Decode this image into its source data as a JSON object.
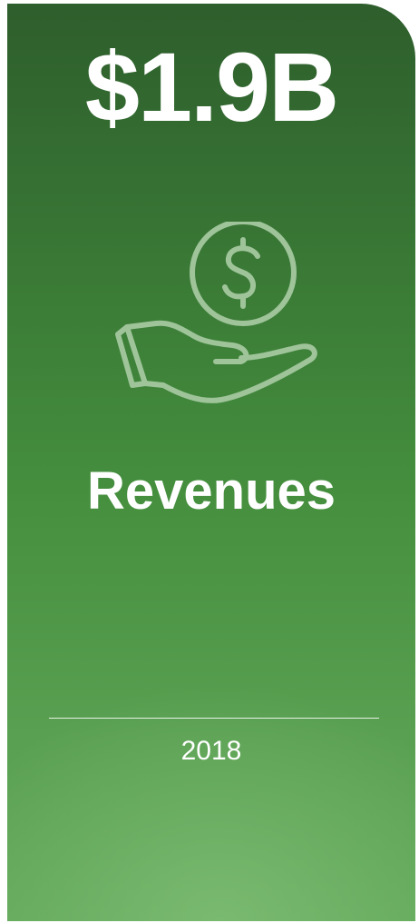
{
  "card": {
    "headline": "$1.9B",
    "label": "Revenues",
    "year": "2018",
    "icon": "hand-holding-dollar-icon",
    "colors": {
      "background_top": "#2e5e2c",
      "background_bottom": "#62a85a",
      "text": "#ffffff",
      "icon_stroke": "#9fc49a"
    }
  }
}
